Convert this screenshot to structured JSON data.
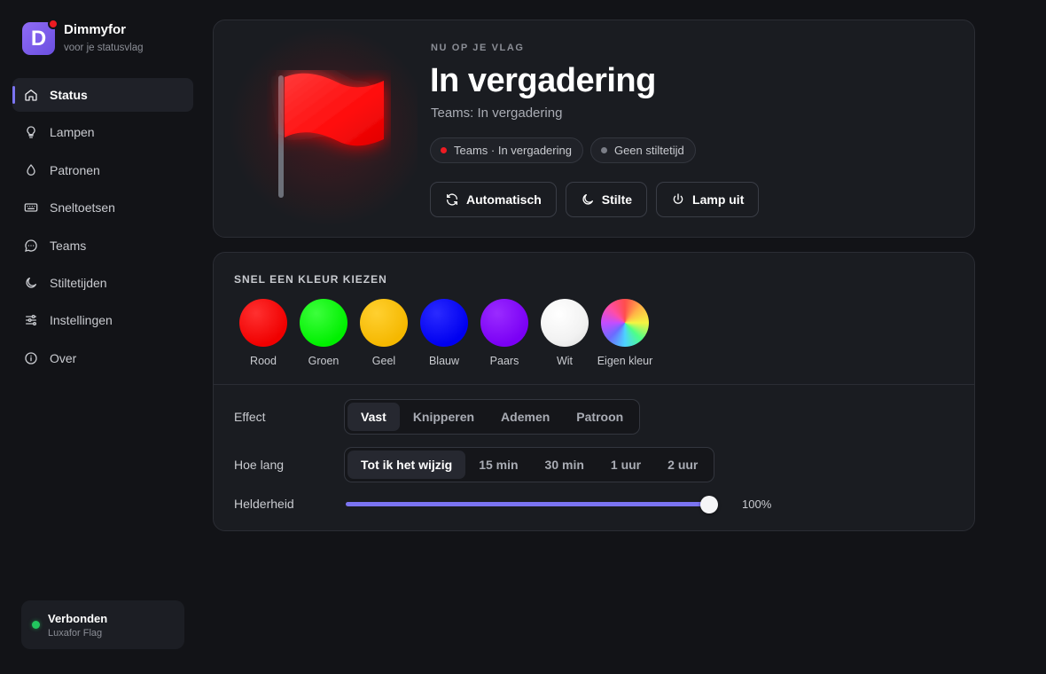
{
  "app": {
    "title": "Dimmyfor",
    "subtitle": "voor je statusvlag"
  },
  "sidebar": {
    "items": [
      {
        "label": "Status",
        "icon": "home-icon",
        "active": true
      },
      {
        "label": "Lampen",
        "icon": "bulb-icon"
      },
      {
        "label": "Patronen",
        "icon": "drop-icon"
      },
      {
        "label": "Sneltoetsen",
        "icon": "keyboard-icon"
      },
      {
        "label": "Teams",
        "icon": "chat-icon"
      },
      {
        "label": "Stiltetijden",
        "icon": "moon-icon"
      },
      {
        "label": "Instellingen",
        "icon": "sliders-icon"
      },
      {
        "label": "Over",
        "icon": "info-icon"
      }
    ],
    "connection": {
      "title": "Verbonden",
      "device": "Luxafor Flag",
      "color": "#22c55e"
    }
  },
  "hero": {
    "eyebrow": "NU OP JE VLAG",
    "title": "In vergadering",
    "subtitle": "Teams: In vergadering",
    "flag_color": "#ff1a1a",
    "chips": [
      {
        "label": "Teams · In vergadering",
        "dot_color": "#ee1b22"
      },
      {
        "label": "Geen stiltetijd",
        "dot_color": "#7b7e87"
      }
    ],
    "actions": [
      {
        "label": "Automatisch",
        "icon": "refresh-icon"
      },
      {
        "label": "Stilte",
        "icon": "moon-icon"
      },
      {
        "label": "Lamp uit",
        "icon": "power-icon"
      }
    ]
  },
  "quick_colors": {
    "heading": "SNEL EEN KLEUR KIEZEN",
    "swatches": [
      {
        "label": "Rood",
        "color": "#ff0000"
      },
      {
        "label": "Groen",
        "color": "#00ff00"
      },
      {
        "label": "Geel",
        "color": "#ffc300"
      },
      {
        "label": "Blauw",
        "color": "#0000ff"
      },
      {
        "label": "Paars",
        "color": "#8000ff"
      },
      {
        "label": "Wit",
        "color": "#ffffff"
      },
      {
        "label": "Eigen kleur",
        "color": "rainbow"
      }
    ]
  },
  "effect": {
    "label": "Effect",
    "options": [
      "Vast",
      "Knipperen",
      "Ademen",
      "Patroon"
    ],
    "selected": "Vast"
  },
  "duration": {
    "label": "Hoe lang",
    "options": [
      "Tot ik het wijzig",
      "15 min",
      "30 min",
      "1 uur",
      "2 uur"
    ],
    "selected": "Tot ik het wijzig"
  },
  "brightness": {
    "label": "Helderheid",
    "value": 100,
    "display": "100%",
    "accent": "#7b74f2"
  }
}
